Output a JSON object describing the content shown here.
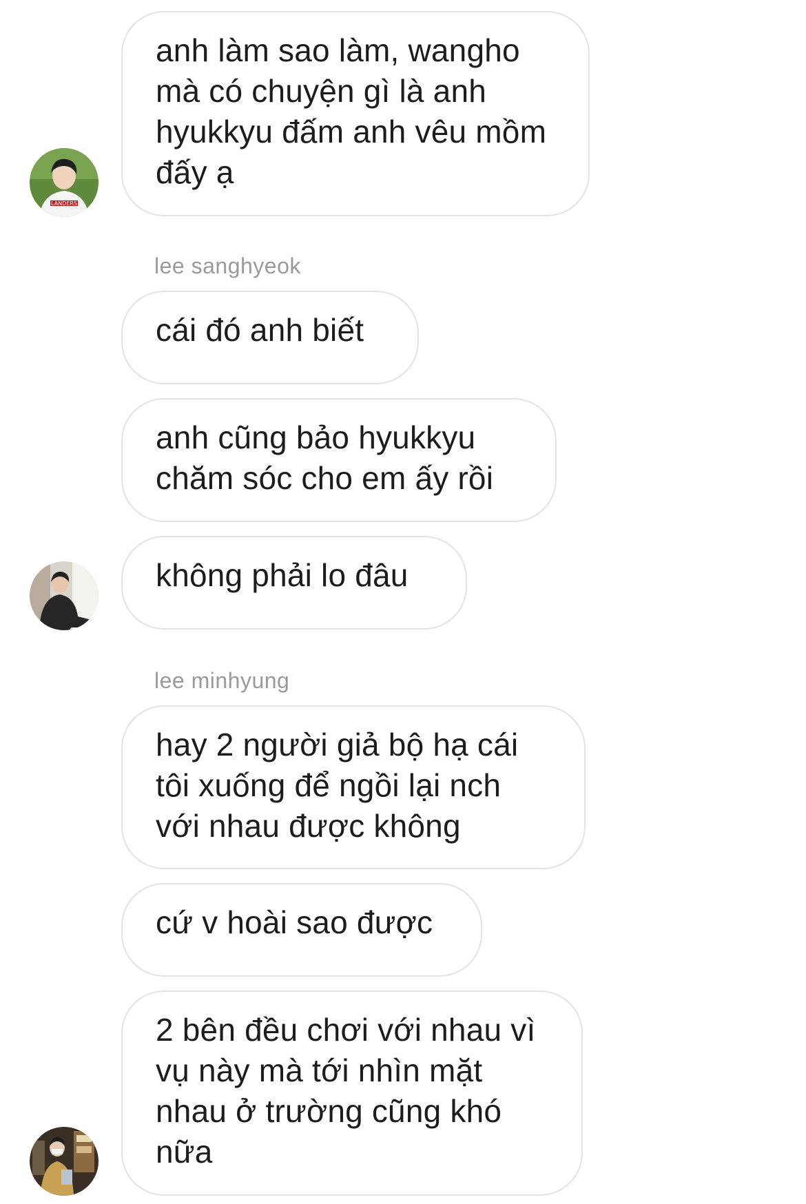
{
  "groups": [
    {
      "sender": "",
      "messages": [
        "anh làm sao làm, wangho mà có chuyện gì là anh hyukkyu đấm anh vêu mồm đấy ạ"
      ],
      "avatar_icon": "profile-photo-avatar"
    },
    {
      "sender": "lee sanghyeok",
      "messages": [
        "cái đó anh biết",
        "anh cũng bảo hyukkyu chăm sóc cho em ấy rồi",
        "không phải lo đâu"
      ],
      "avatar_icon": "profile-photo-avatar"
    },
    {
      "sender": "lee minhyung",
      "messages": [
        "hay 2 người giả bộ hạ cái tôi xuống để ngồi lại nch với nhau được không",
        "cứ v hoài sao được",
        "2 bên đều chơi với nhau vì vụ này mà tới nhìn mặt nhau ở trường cũng khó nữa"
      ],
      "avatar_icon": "profile-photo-avatar"
    }
  ],
  "colors": {
    "background": "#ffffff",
    "bubble_border": "#e3e3e3",
    "text": "#1c1c1c",
    "sender_name": "#9a9a9a"
  }
}
